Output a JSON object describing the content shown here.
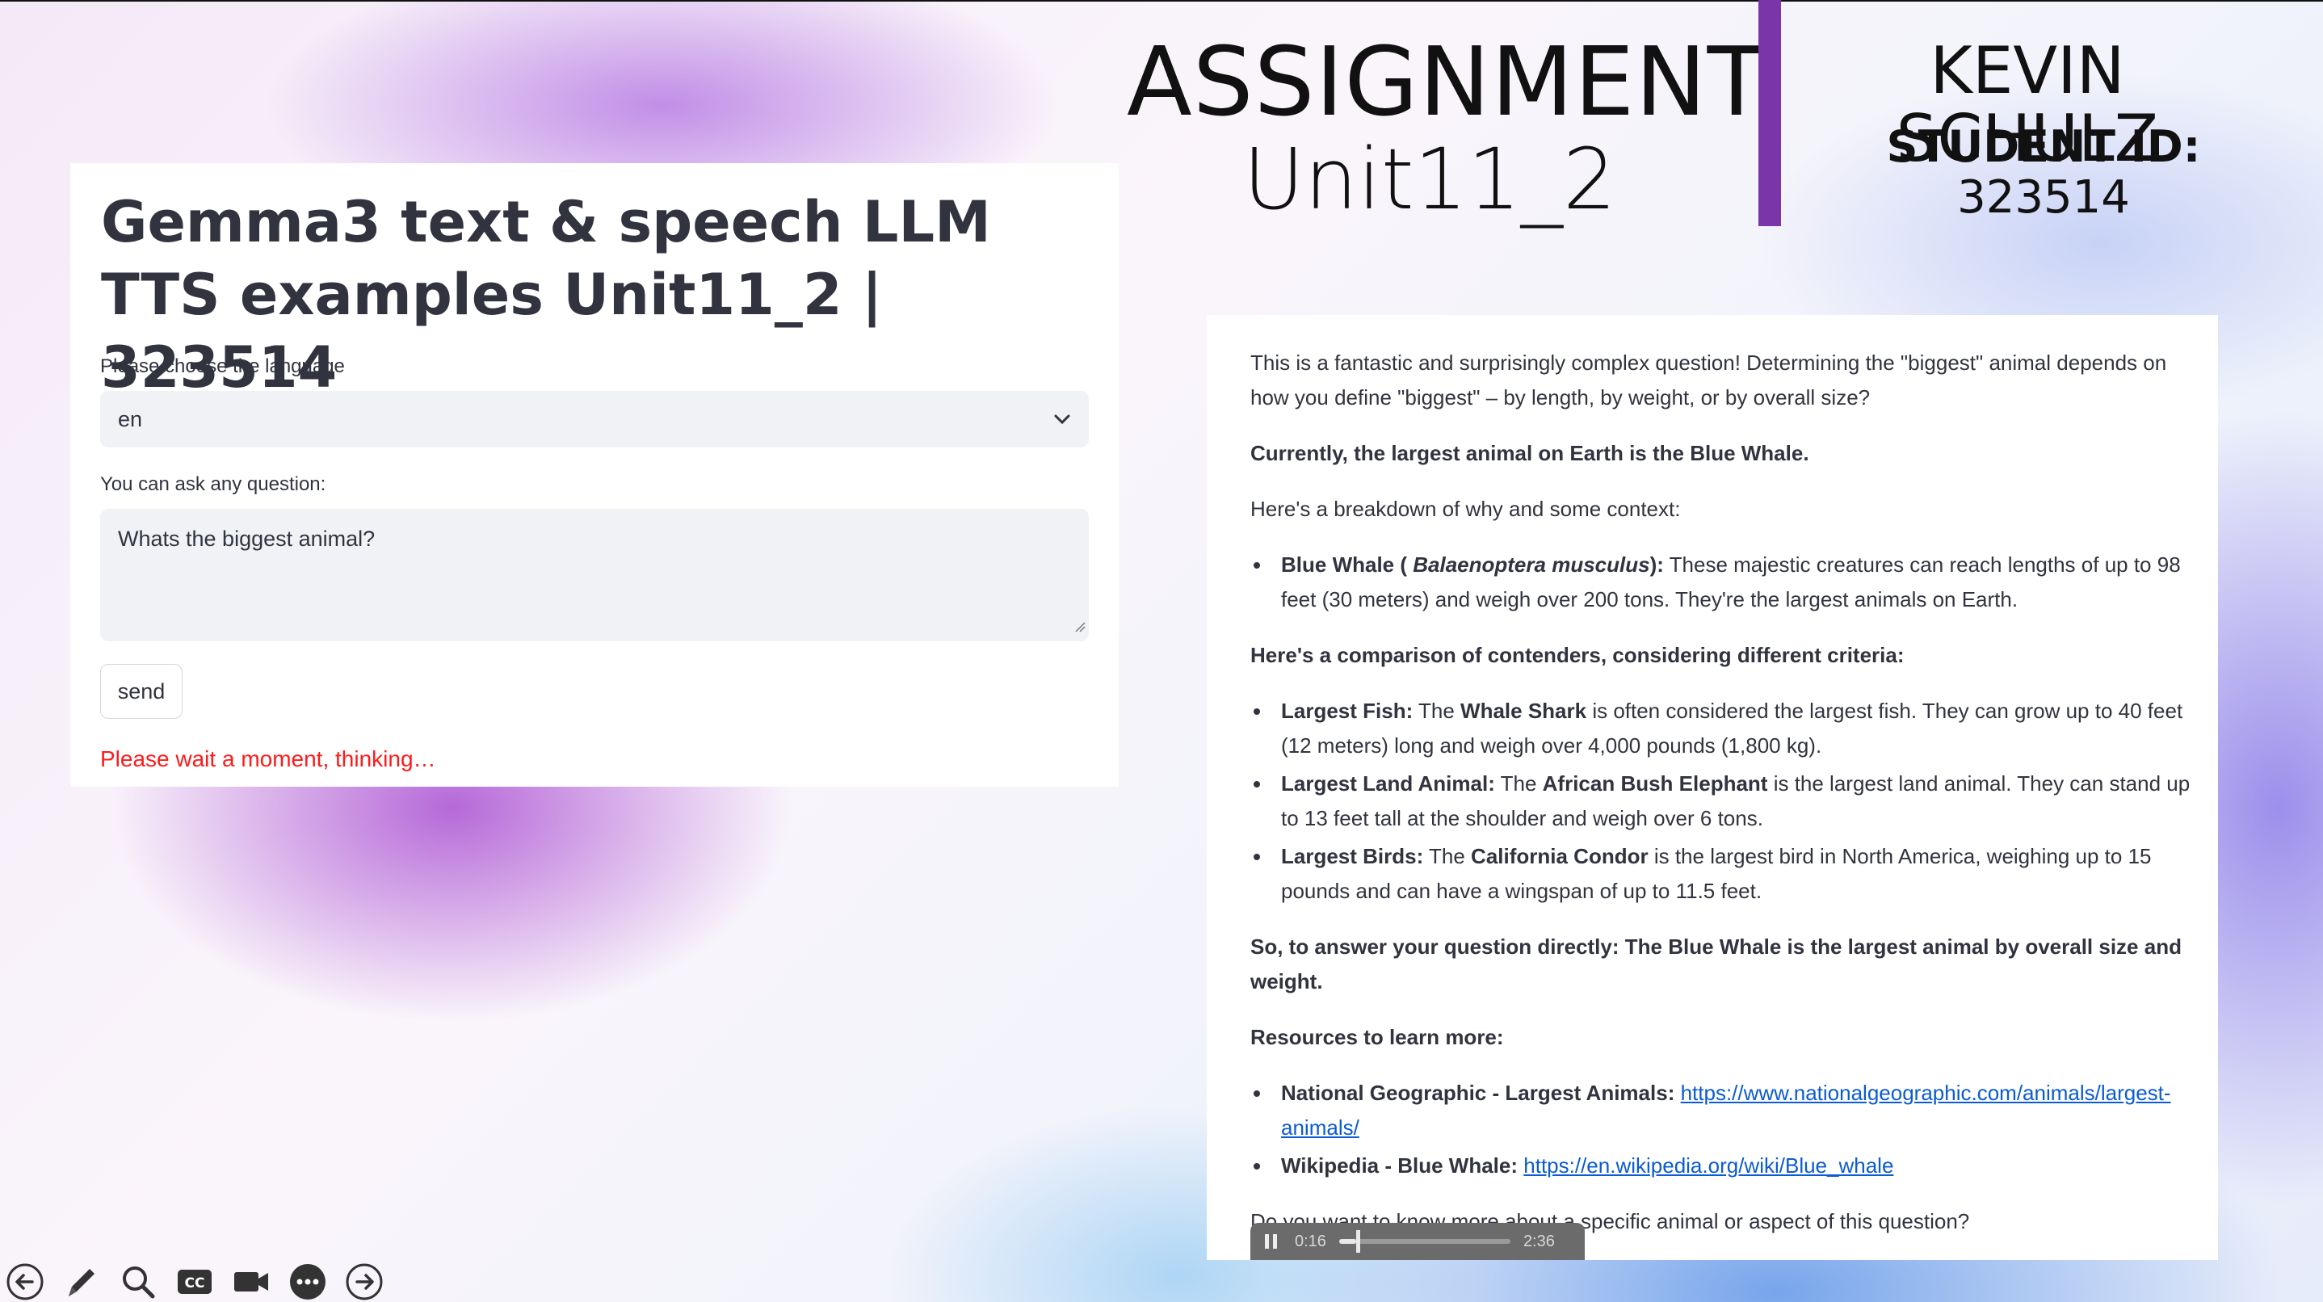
{
  "header": {
    "assignment": "ASSIGNMENT",
    "unit": "Unit11_2",
    "student_name": "KEVIN SCHULZ",
    "student_id_label": "STUDENT ID:",
    "student_id": "323514",
    "accent_color": "#7a36a8"
  },
  "app": {
    "title": "Gemma3 text & speech LLM TTS examples Unit11_2 | 323514",
    "language_label": "Please choose the language",
    "language_value": "en",
    "question_label": "You can ask any question:",
    "question_value": "Whats the biggest animal?",
    "send_label": "send",
    "status": "Please wait a moment, thinking…"
  },
  "answer": {
    "intro": "This is a fantastic and surprisingly complex question! Determining the \"biggest\" animal depends on how you define \"biggest\" – by length, by weight, or by overall size?",
    "current": "Currently, the largest animal on Earth is the Blue Whale.",
    "breakdown": "Here's a breakdown of why and some context:",
    "whale_term": "Blue Whale ( ",
    "whale_species": "Balaenoptera musculus",
    "whale_term_end": "):",
    "whale_text": " These majestic creatures can reach lengths of up to 98 feet (30 meters) and weigh over 200 tons. They're the largest animals on Earth.",
    "comparison_heading": "Here's a comparison of contenders, considering different criteria:",
    "fish_label": "Largest Fish:",
    "fish_pre": " The ",
    "fish_name": "Whale Shark",
    "fish_text": " is often considered the largest fish. They can grow up to 40 feet (12 meters) long and weigh over 4,000 pounds (1,800 kg).",
    "land_label": "Largest Land Animal:",
    "land_pre": " The ",
    "land_name": "African Bush Elephant",
    "land_text": " is the largest land animal. They can stand up to 13 feet tall at the shoulder and weigh over 6 tons.",
    "birds_label": "Largest Birds:",
    "birds_pre": " The ",
    "birds_name": "California Condor",
    "birds_text": " is the largest bird in North America, weighing up to 15 pounds and can have a wingspan of up to 11.5 feet.",
    "direct": "So, to answer your question directly: The Blue Whale is the largest animal by overall size and weight.",
    "resources_heading": "Resources to learn more:",
    "res1_label": "National Geographic - Largest Animals:",
    "res1_link": "https://www.nationalgeographic.com/animals/largest-animals/",
    "res2_label": "Wikipedia - Blue Whale:",
    "res2_link": "https://en.wikipedia.org/wiki/Blue_whale",
    "followup": "Do you want to know more about a specific animal or aspect of this question?"
  },
  "audio": {
    "current_time": "0:16",
    "duration": "2:36",
    "progress": 0.1
  },
  "toolbar": {
    "icons": [
      "back-arrow-icon",
      "pen-icon",
      "zoom-icon",
      "captions-icon",
      "camera-icon",
      "more-icon",
      "forward-arrow-icon"
    ]
  }
}
